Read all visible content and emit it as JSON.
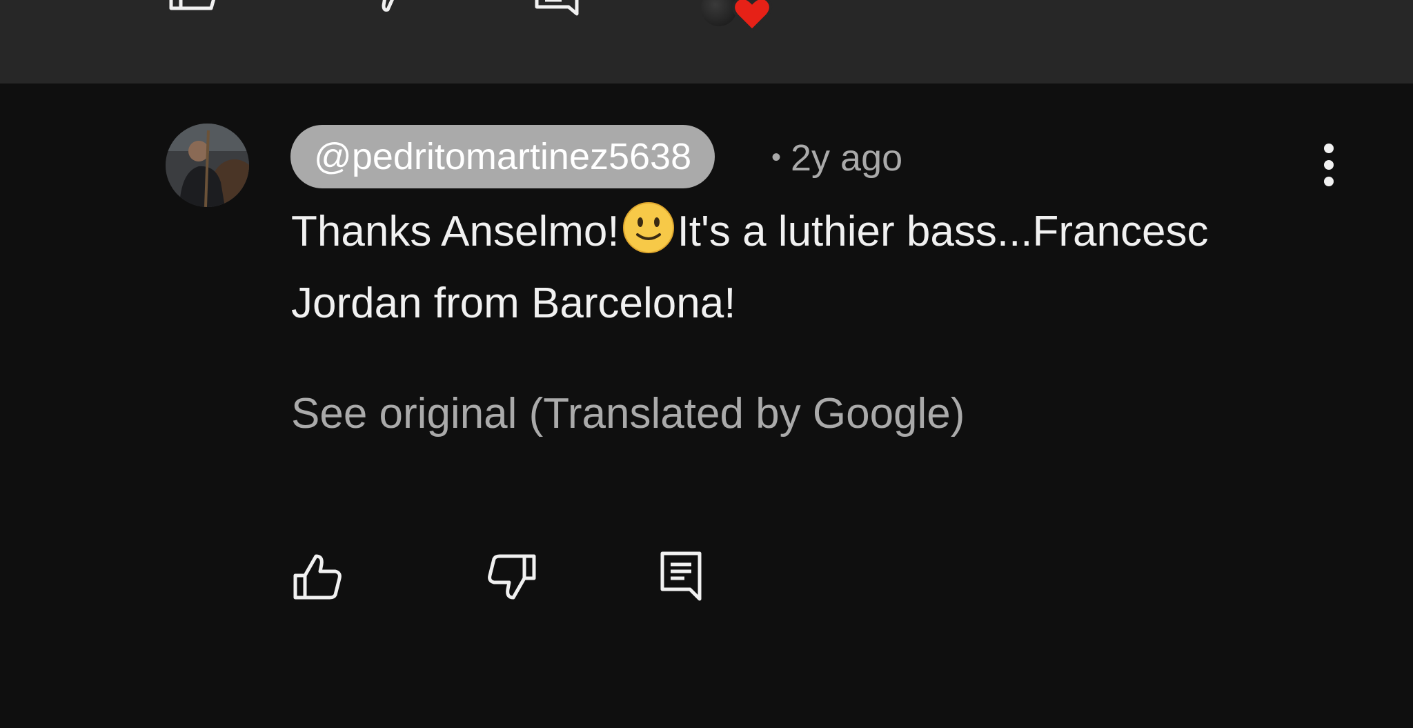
{
  "comment": {
    "author": "@pedritomartinez5638",
    "separator": "•",
    "timestamp": "2y ago",
    "text_part1": "Thanks Anselmo!",
    "emoji": "slightly-smiling-face",
    "text_part2": "It's a luthier bass...Francesc Jordan from Barcelona!",
    "translation_link": "See original (Translated by Google)",
    "menu_icon": "more-vert-icon",
    "actions": [
      "like-icon",
      "dislike-icon",
      "reply-icon"
    ]
  },
  "previous_comment_actions": [
    "like-icon",
    "dislike-icon",
    "reply-icon",
    "creator-heart-icon"
  ],
  "colors": {
    "background": "#0f0f0f",
    "top_band": "#272727",
    "author_chip": "#aaaaaa",
    "text_primary": "#f1f1f1",
    "text_secondary": "#aaaaaa",
    "heart": "#e62117"
  }
}
